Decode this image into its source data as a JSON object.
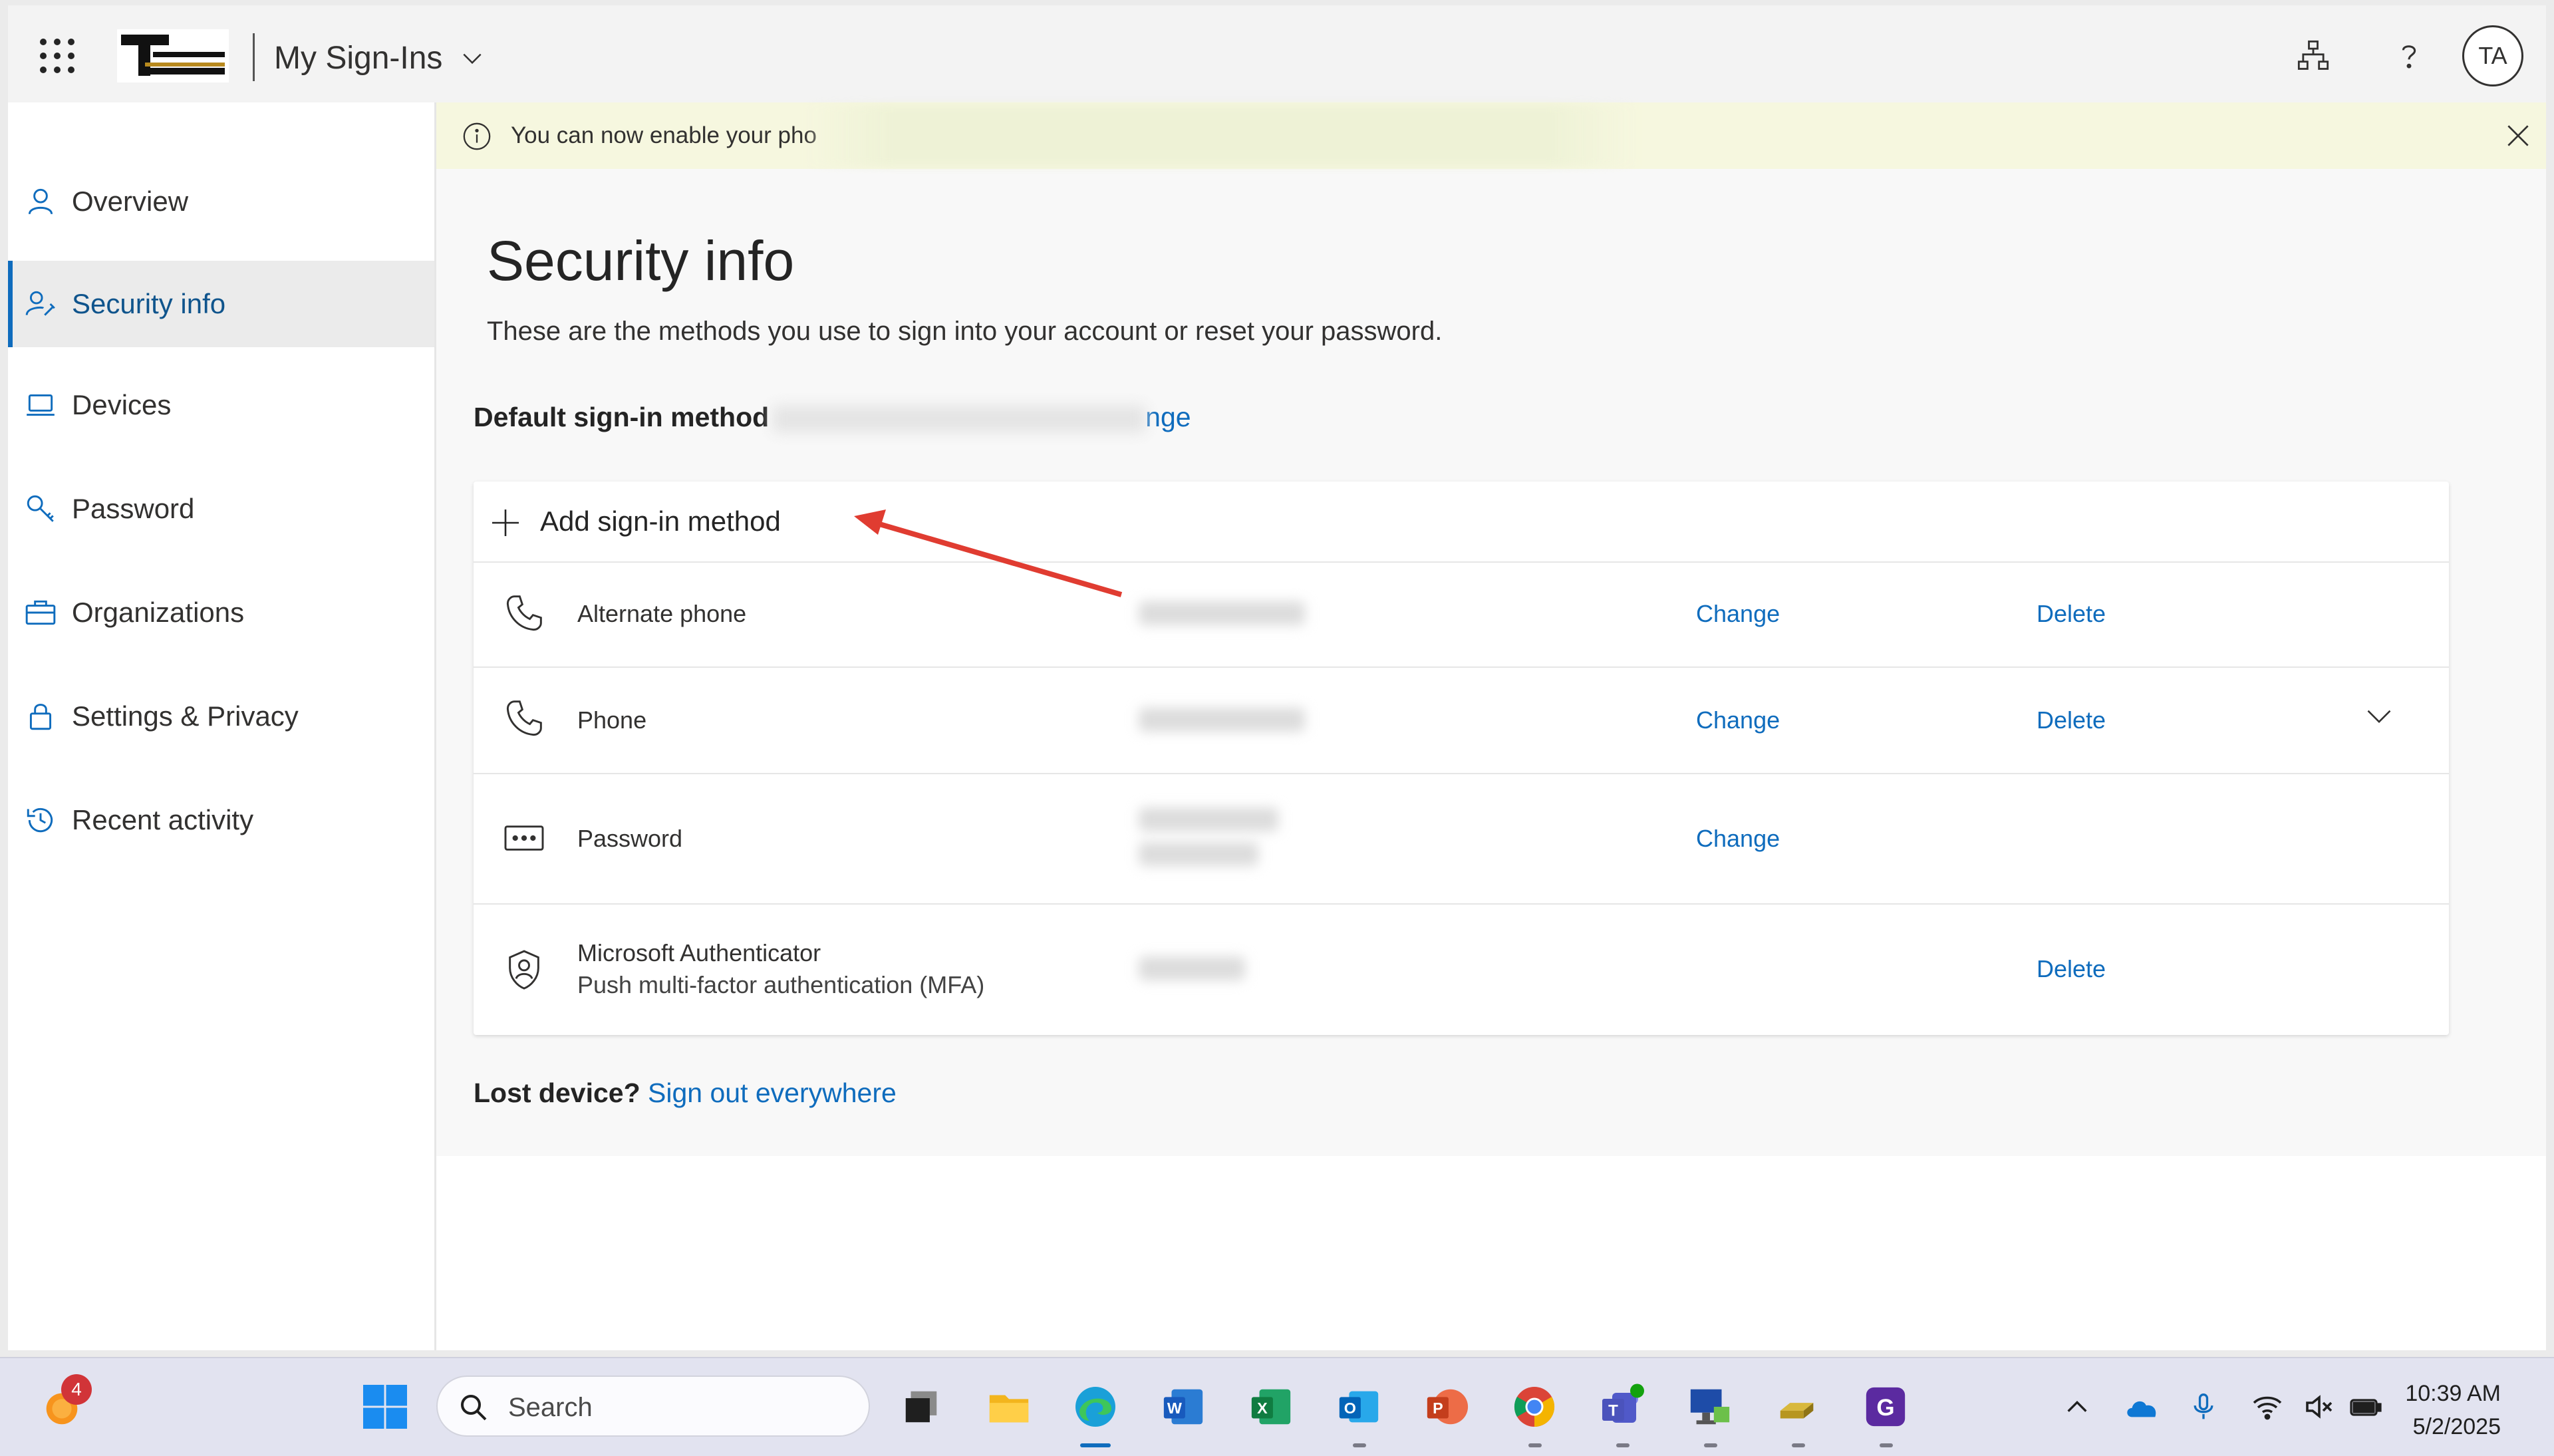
{
  "header": {
    "app_title": "My Sign-Ins",
    "avatar_initials": "TA",
    "icons": [
      "waffle-icon",
      "org-chart-icon",
      "help-icon"
    ]
  },
  "sidebar": {
    "items": [
      {
        "label": "Overview",
        "icon": "person-icon",
        "active": false
      },
      {
        "label": "Security info",
        "icon": "person-key-icon",
        "active": true
      },
      {
        "label": "Devices",
        "icon": "laptop-icon",
        "active": false
      },
      {
        "label": "Password",
        "icon": "key-icon",
        "active": false
      },
      {
        "label": "Organizations",
        "icon": "briefcase-icon",
        "active": false
      },
      {
        "label": "Settings & Privacy",
        "icon": "lock-icon",
        "active": false
      },
      {
        "label": "Recent activity",
        "icon": "history-icon",
        "active": false
      }
    ]
  },
  "banner": {
    "text": "You can now enable your pho"
  },
  "main": {
    "title": "Security info",
    "description": "These are the methods you use to sign into your account or reset your password.",
    "default_method_label": "Default sign-in method",
    "default_method_change": "nge",
    "add_method_label": "Add sign-in method",
    "methods": [
      {
        "name": "Alternate phone",
        "sub": "",
        "change": "Change",
        "delete": "Delete",
        "icon": "phone-icon"
      },
      {
        "name": "Phone",
        "sub": "",
        "change": "Change",
        "delete": "Delete",
        "icon": "phone-icon"
      },
      {
        "name": "Password",
        "sub": "",
        "change": "Change",
        "delete": "",
        "icon": "password-icon"
      },
      {
        "name": "Microsoft Authenticator",
        "sub": "Push multi-factor authentication (MFA)",
        "change": "",
        "delete": "Delete",
        "icon": "authenticator-icon"
      }
    ],
    "lost_device_label": "Lost device?",
    "sign_out_link": "Sign out everywhere"
  },
  "taskbar": {
    "search_placeholder": "Search",
    "notification_count": "4",
    "time": "10:39 AM",
    "date": "5/2/2025",
    "colors": {
      "accent": "#0f6cbd",
      "banner": "#f6f7df"
    }
  }
}
